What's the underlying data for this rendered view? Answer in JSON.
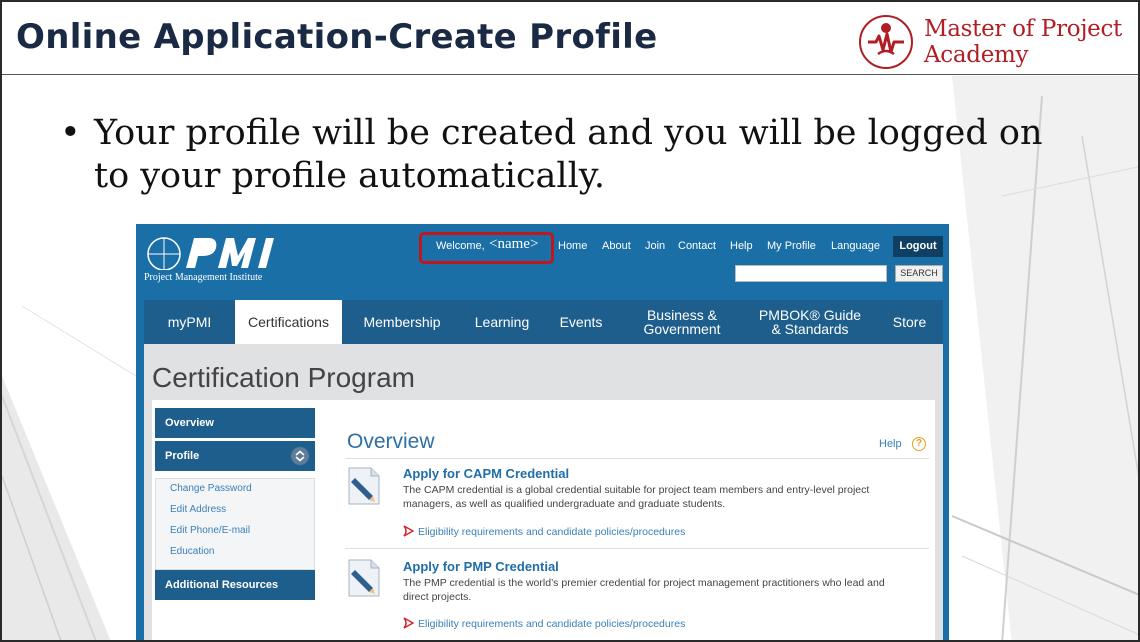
{
  "slide": {
    "title": "Online Application-Create Profile",
    "logo_line1": "Master of Project",
    "logo_line2": "Academy",
    "bullet": "Your profile will be created and you will be logged on to your profile automatically."
  },
  "pmi": {
    "logo_subtitle": "Project Management Institute",
    "welcome_label": "Welcome,",
    "welcome_name": "<name>",
    "top_links": [
      "Home",
      "About",
      "Join",
      "Contact",
      "Help",
      "My Profile",
      "Language"
    ],
    "logout_label": "Logout",
    "search_value": "",
    "search_label": "SEARCH",
    "nav_tabs": [
      {
        "label": "myPMI"
      },
      {
        "label": "Certifications",
        "active": true
      },
      {
        "label": "Membership"
      },
      {
        "label": "Learning"
      },
      {
        "label": "Events"
      },
      {
        "label": "Business &\nGovernment"
      },
      {
        "label": "PMBOK® Guide\n& Standards"
      },
      {
        "label": "Store"
      }
    ],
    "page_title": "Certification Program",
    "sidebar": {
      "overview": "Overview",
      "profile": "Profile",
      "links": [
        "Change Password",
        "Edit Address",
        "Edit Phone/E-mail",
        "Education"
      ],
      "additional": "Additional Resources"
    },
    "main": {
      "title": "Overview",
      "help_label": "Help",
      "help_icon": "?",
      "items": [
        {
          "title": "Apply for CAPM Credential",
          "description": "The CAPM credential is a global credential suitable for project team members and entry-level project managers, as well as qualified undergraduate and graduate students.",
          "link": "Eligibility requirements and candidate policies/procedures"
        },
        {
          "title": "Apply for PMP Credential",
          "description": "The PMP credential is the world’s premier credential for project management practitioners who lead and direct projects.",
          "link": "Eligibility requirements and candidate policies/procedures"
        }
      ]
    }
  },
  "colors": {
    "title": "#1b2a44",
    "logo_red": "#b01e24",
    "pmi_blue": "#1a6fa7",
    "nav_blue": "#1e5e8c",
    "highlight_red": "#c0161c",
    "link_blue": "#3a7fb8"
  }
}
